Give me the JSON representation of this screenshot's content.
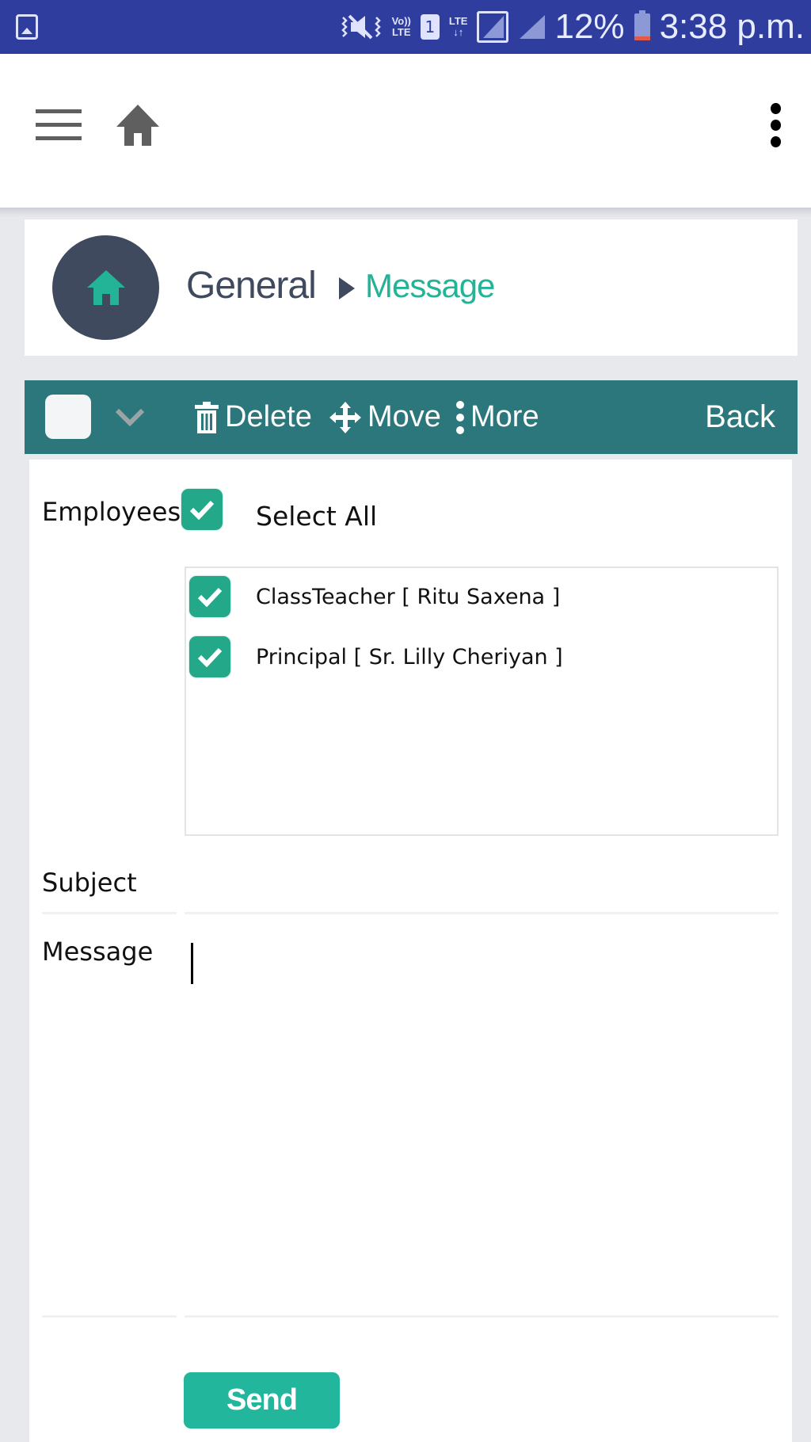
{
  "status_bar": {
    "left_icon": "gallery-notification-icon",
    "icons": [
      "vibrate-mute-icon",
      "volte-icon",
      "sim-1-icon",
      "lte-data-icon",
      "signal-sim1-icon",
      "signal-sim2-icon"
    ],
    "volte_label_top": "Vo))",
    "volte_label_bottom": "LTE",
    "sim_label": "1",
    "lte_label": "LTE",
    "lte_arrows": "↓↑",
    "battery_percent": "12%",
    "battery_level": 0.12,
    "time": "3:38 p.m."
  },
  "app_bar": {
    "menu_icon": "hamburger-icon",
    "home_icon": "home-icon",
    "overflow_icon": "more-vert-icon"
  },
  "breadcrumb": {
    "root": "General",
    "separator_icon": "triangle-right-icon",
    "current": "Message"
  },
  "toolbar": {
    "delete_label": "Delete",
    "move_label": "Move",
    "more_label": "More",
    "back_label": "Back",
    "select_checked": false
  },
  "form": {
    "employees_label": "Employees",
    "select_all_label": "Select All",
    "select_all_checked": true,
    "employees": [
      {
        "label": "ClassTeacher [ Ritu Saxena ]",
        "checked": true
      },
      {
        "label": "Principal [ Sr. Lilly Cheriyan ]",
        "checked": true
      }
    ],
    "subject_label": "Subject",
    "subject_value": "",
    "message_label": "Message",
    "message_value": "",
    "send_label": "Send"
  },
  "colors": {
    "status_bar": "#2f3e9e",
    "toolbar": "#2b777c",
    "accent": "#23b497",
    "avatar": "#3f4a5e",
    "checkbox": "#24a88a"
  }
}
